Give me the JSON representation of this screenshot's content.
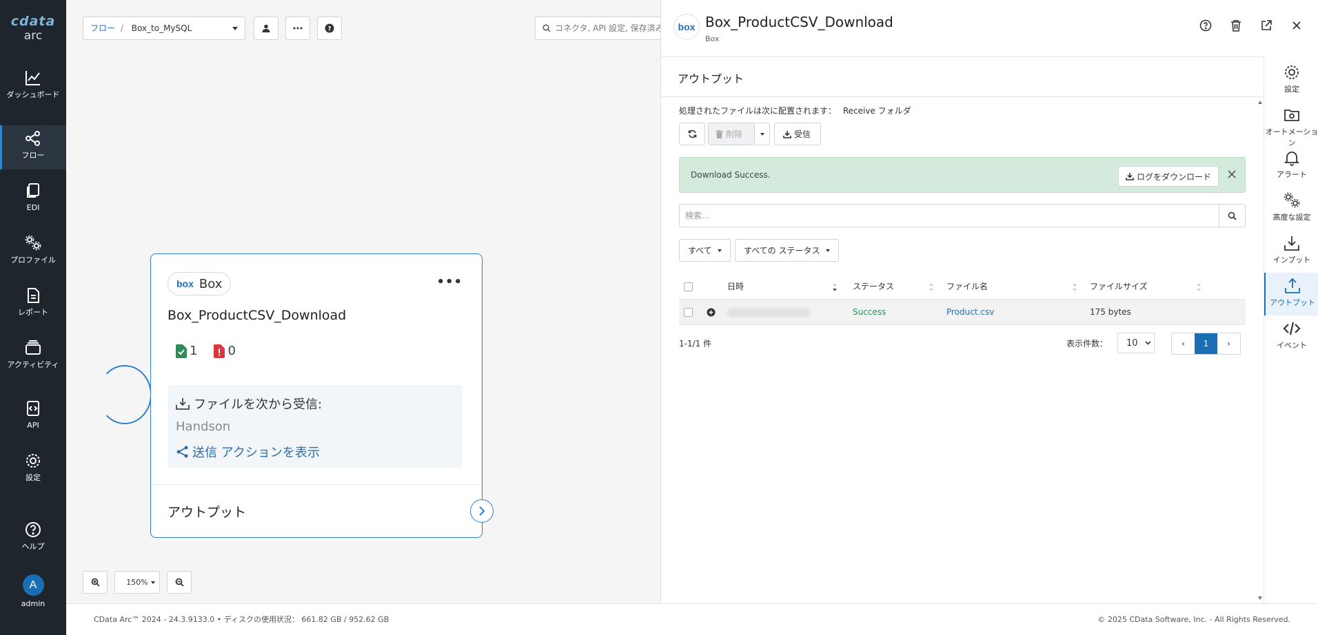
{
  "app": {
    "logo_top": "cdata",
    "logo_bottom": "arc"
  },
  "nav": {
    "items": [
      {
        "label": "ダッシュボード"
      },
      {
        "label": "フロー"
      },
      {
        "label": "EDI"
      },
      {
        "label": "プロファイル"
      },
      {
        "label": "レポート"
      },
      {
        "label": "アクティビティ"
      },
      {
        "label": "API"
      },
      {
        "label": "設定"
      },
      {
        "label": "ヘルプ"
      }
    ],
    "user": {
      "initial": "A",
      "name": "admin"
    }
  },
  "canvas": {
    "breadcrumb": {
      "root": "フロー",
      "sep": "/",
      "current": "Box_to_MySQL"
    },
    "search_placeholder": "コネクタ, API 設定, 保存済み",
    "zoom_level": "150%",
    "node": {
      "badge_text": "box",
      "connector_type": "Box",
      "more_icon": "•••",
      "title": "Box_ProductCSV_Download",
      "success_count": "1",
      "error_count": "0",
      "receive_label": "ファイルを次から受信:",
      "receive_folder": "Handson",
      "send_action_label": "送信 アクションを表示",
      "output_label": "アウトプット"
    }
  },
  "panel": {
    "logo_text": "box",
    "title": "Box_ProductCSV_Download",
    "subtitle": "Box",
    "section_title": "アウトプット",
    "location_prefix": "処理されたファイルは次に配置されます：",
    "location_value": "Receive フォルダ",
    "toolbar": {
      "delete_label": "削除",
      "receive_label": "受信"
    },
    "alert": {
      "message": "Download Success.",
      "button_label": "ログをダウンロード"
    },
    "search_placeholder": "検索...",
    "filters": {
      "all": "すべて",
      "status": "すべての ステータス"
    },
    "table": {
      "headers": [
        "日時",
        "ステータス",
        "ファイル名",
        "ファイルサイズ"
      ],
      "rows": [
        {
          "status": "Success",
          "file": "Product.csv",
          "size": "175 bytes"
        }
      ]
    },
    "pagination": {
      "info": "1-1/1 件",
      "per_page_label": "表示件数：",
      "per_page": "10",
      "current_page": "1",
      "prev": "‹",
      "next": "›"
    },
    "rail": [
      {
        "label": "設定"
      },
      {
        "label": "オートメーション"
      },
      {
        "label": "アラート"
      },
      {
        "label": "高度な設定"
      },
      {
        "label": "インプット"
      },
      {
        "label": "アウトプット"
      },
      {
        "label": "イベント"
      }
    ]
  },
  "footer": {
    "left": "CData Arc™ 2024 - 24.3.9133.0 • ディスクの使用状況： 661.82 GB / 952.62 GB",
    "right": "© 2025 CData Software, Inc. - All Rights Reserved."
  },
  "colors": {
    "accent": "#1a6eb3",
    "nav_bg": "#1e252c",
    "alert_bg": "#d4eadc",
    "success": "#2e8b57",
    "error": "#d9363e"
  }
}
